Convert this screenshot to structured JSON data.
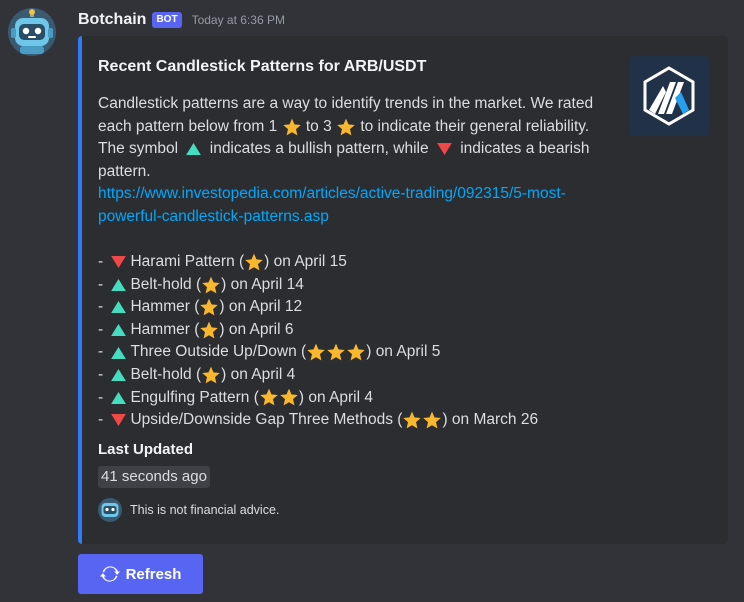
{
  "message": {
    "username": "Botchain",
    "badge": "BOT",
    "timestamp": "Today at 6:36 PM"
  },
  "embed": {
    "accent_color": "#2e7cf6",
    "title": "Recent Candlestick Patterns for ARB/USDT",
    "desc_1": "Candlestick patterns are a way to identify trends in the market. We rated each pattern below from 1",
    "desc_2": "to 3",
    "desc_3": "to indicate their general reliability. The symbol",
    "desc_4": "indicates a bullish pattern, while",
    "desc_5": "indicates a bearish pattern.",
    "link": "https://www.investopedia.com/articles/active-trading/092315/5-most-powerful-candlestick-patterns.asp",
    "patterns": [
      {
        "direction": "bearish",
        "name": "Harami Pattern",
        "stars": 1,
        "date": "on April 15"
      },
      {
        "direction": "bullish",
        "name": "Belt-hold",
        "stars": 1,
        "date": "on April 14"
      },
      {
        "direction": "bullish",
        "name": "Hammer",
        "stars": 1,
        "date": "on April 12"
      },
      {
        "direction": "bullish",
        "name": "Hammer",
        "stars": 1,
        "date": "on April 6"
      },
      {
        "direction": "bullish",
        "name": "Three Outside Up/Down",
        "stars": 3,
        "date": "on April 5"
      },
      {
        "direction": "bullish",
        "name": "Belt-hold",
        "stars": 1,
        "date": "on April 4"
      },
      {
        "direction": "bullish",
        "name": "Engulfing Pattern",
        "stars": 2,
        "date": "on April 4"
      },
      {
        "direction": "bearish",
        "name": "Upside/Downside Gap Three Methods",
        "stars": 2,
        "date": "on March 26"
      }
    ],
    "last_updated_label": "Last Updated",
    "last_updated_value": "41 seconds ago",
    "footer_text": "This is not financial advice."
  },
  "refresh_button": {
    "label": "Refresh",
    "icon": "refresh-icon"
  },
  "colors": {
    "bullish": "#45ddc0",
    "bearish": "#f04747",
    "star": "#f9b72d",
    "link": "#00a8fc",
    "button": "#5865f2"
  }
}
